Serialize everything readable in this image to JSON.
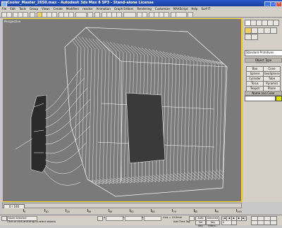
{
  "window": {
    "title": "Cooler_Master_2650.max - Autodesk 3ds Max 8 SP3 - Stand-alone License"
  },
  "menu": [
    "File",
    "Edit",
    "Tools",
    "Group",
    "Views",
    "Create",
    "Modifiers",
    "reactor",
    "Animation",
    "Graph Editors",
    "Rendering",
    "Customize",
    "MAXScript",
    "Help",
    "Surf-IT"
  ],
  "viewport": {
    "label": "Perspective"
  },
  "command_panel": {
    "dropdown": "Standard Primitives",
    "object_type_header": "Object Type",
    "autogrid": "AutoGrid",
    "objects": [
      "Box",
      "Cone",
      "Sphere",
      "GeoSphere",
      "Cylinder",
      "Tube",
      "Torus",
      "Pyramid",
      "Teapot",
      "Plane"
    ],
    "name_color_header": "Name and Color"
  },
  "timeline": {
    "slider": "0 / 100",
    "ticks": [
      "0",
      "10",
      "20",
      "30",
      "40",
      "50",
      "60",
      "70",
      "80",
      "90",
      "100"
    ]
  },
  "status": {
    "selection": "None Selected",
    "prompt": "Click or click-and-drag to select objects",
    "x_label": "X",
    "y_label": "Y",
    "z_label": "Z",
    "grid": "Grid = 10.0mm",
    "add_time_tag": "Add Time Tag",
    "auto_key": "Auto Key",
    "selected": "Selected",
    "set_key": "Set Key",
    "key_filters": "Key Filters...",
    "frame": "0"
  },
  "colors": {
    "title_bar": "#1a3f9e",
    "auto_key": "#d04030",
    "object_color": "#e0e000",
    "viewport_border": "#ffd000"
  }
}
